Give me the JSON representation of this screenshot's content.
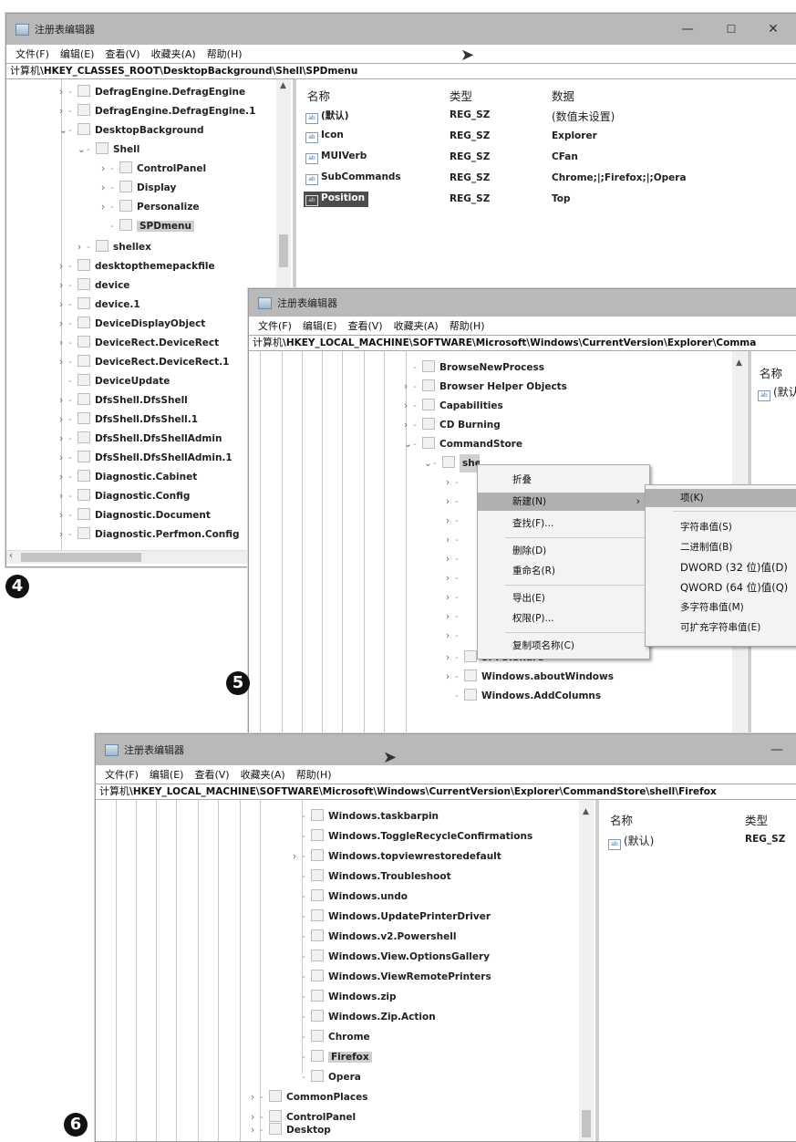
{
  "w1": {
    "title": "注册表编辑器",
    "menus": [
      "文件(F)",
      "编辑(E)",
      "查看(V)",
      "收藏夹(A)",
      "帮助(H)"
    ],
    "path_prefix": "计算机",
    "path": "\\HKEY_CLASSES_ROOT\\DesktopBackground\\Shell\\SPDmenu",
    "minimize": "—",
    "maximize": "☐",
    "close": "✕",
    "tree": [
      "DefragEngine.DefragEngine",
      "DefragEngine.DefragEngine.1",
      "DesktopBackground",
      "Shell",
      "ControlPanel",
      "Display",
      "Personalize",
      "SPDmenu",
      "shellex",
      "desktopthemepackfile",
      "device",
      "device.1",
      "DeviceDisplayObject",
      "DeviceRect.DeviceRect",
      "DeviceRect.DeviceRect.1",
      "DeviceUpdate",
      "DfsShell.DfsShell",
      "DfsShell.DfsShell.1",
      "DfsShell.DfsShellAdmin",
      "DfsShell.DfsShellAdmin.1",
      "Diagnostic.Cabinet",
      "Diagnostic.Config",
      "Diagnostic.Document",
      "Diagnostic.Perfmon.Config"
    ],
    "columns": [
      "名称",
      "类型",
      "数据"
    ],
    "rows": [
      {
        "name": "(默认)",
        "type": "REG_SZ",
        "data": "(数值未设置)"
      },
      {
        "name": "Icon",
        "type": "REG_SZ",
        "data": "Explorer"
      },
      {
        "name": "MUIVerb",
        "type": "REG_SZ",
        "data": "CFan"
      },
      {
        "name": "SubCommands",
        "type": "REG_SZ",
        "data": "Chrome;|;Firefox;|;Opera"
      },
      {
        "name": "Position",
        "type": "REG_SZ",
        "data": "Top"
      }
    ]
  },
  "w2": {
    "title": "注册表编辑器",
    "menus": [
      "文件(F)",
      "编辑(E)",
      "查看(V)",
      "收藏夹(A)",
      "帮助(H)"
    ],
    "path_prefix": "计算机",
    "path": "\\HKEY_LOCAL_MACHINE\\SOFTWARE\\Microsoft\\Windows\\CurrentVersion\\Explorer\\Comma",
    "tree": [
      "BrowseNewProcess",
      "Browser Helper Objects",
      "Capabilities",
      "CD Burning",
      "CommandStore",
      "shell",
      "SPFS.Share",
      "Windows.aboutWindows",
      "Windows.AddColumns"
    ],
    "columns": [
      "名称"
    ],
    "row_name": "(默认)",
    "context_menu": [
      "折叠",
      "新建(N)",
      "查找(F)...",
      "删除(D)",
      "重命名(R)",
      "导出(E)",
      "权限(P)...",
      "复制项名称(C)"
    ],
    "submenu": [
      "项(K)",
      "字符串值(S)",
      "二进制值(B)",
      "DWORD (32 位)值(D)",
      "QWORD (64 位)值(Q)",
      "多字符串值(M)",
      "可扩充字符串值(E)"
    ]
  },
  "w3": {
    "title": "注册表编辑器",
    "menus": [
      "文件(F)",
      "编辑(E)",
      "查看(V)",
      "收藏夹(A)",
      "帮助(H)"
    ],
    "path_prefix": "计算机",
    "path": "\\HKEY_LOCAL_MACHINE\\SOFTWARE\\Microsoft\\Windows\\CurrentVersion\\Explorer\\CommandStore\\shell\\Firefox",
    "tree": [
      "Windows.taskbarpin",
      "Windows.ToggleRecycleConfirmations",
      "Windows.topviewrestoredefault",
      "Windows.Troubleshoot",
      "Windows.undo",
      "Windows.UpdatePrinterDriver",
      "Windows.v2.Powershell",
      "Windows.View.OptionsGallery",
      "Windows.ViewRemotePrinters",
      "Windows.zip",
      "Windows.Zip.Action",
      "Chrome",
      "Firefox",
      "Opera",
      "CommonPlaces",
      "ControlPanel",
      "Desktop"
    ],
    "columns": [
      "名称",
      "类型"
    ],
    "row_name": "(默认)",
    "row_type": "REG_SZ"
  },
  "badges": [
    "4",
    "5",
    "6"
  ]
}
